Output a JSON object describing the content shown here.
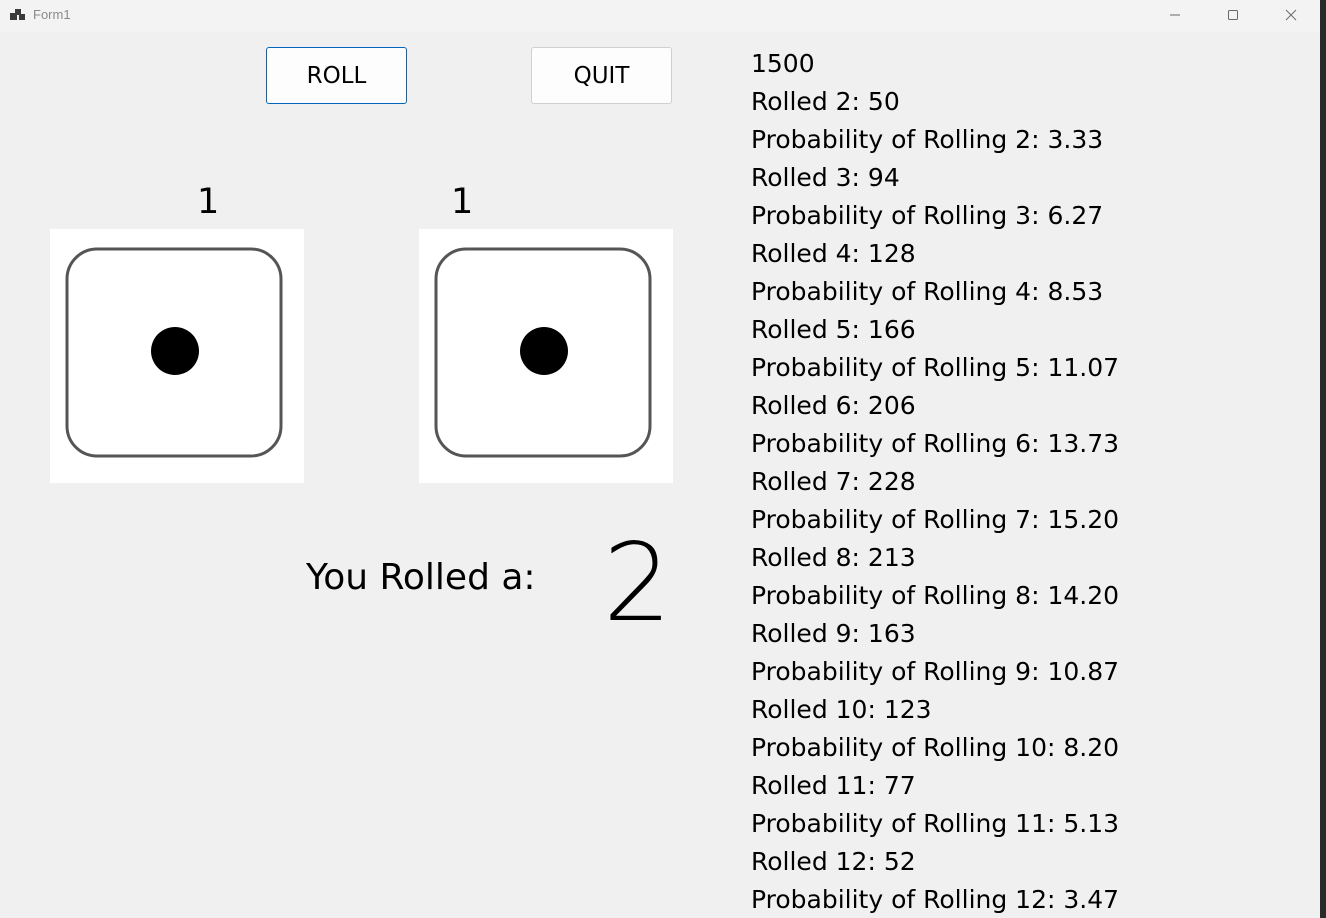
{
  "window": {
    "title": "Form1"
  },
  "buttons": {
    "roll": "ROLL",
    "quit": "QUIT"
  },
  "dice": {
    "die1_value": "1",
    "die2_value": "1"
  },
  "result": {
    "label": "You Rolled a:",
    "total": "2"
  },
  "stats": {
    "total_rolls": "1500",
    "lines": [
      "Rolled 2: 50",
      "Probability of Rolling 2: 3.33",
      "Rolled 3: 94",
      "Probability of Rolling 3: 6.27",
      "Rolled 4: 128",
      "Probability of Rolling 4: 8.53",
      "Rolled 5: 166",
      "Probability of Rolling 5: 11.07",
      "Rolled 6: 206",
      "Probability of Rolling 6: 13.73",
      "Rolled 7: 228",
      "Probability of Rolling 7: 15.20",
      "Rolled 8: 213",
      "Probability of Rolling 8: 14.20",
      "Rolled 9: 163",
      "Probability of Rolling 9: 10.87",
      "Rolled 10: 123",
      "Probability of Rolling 10: 8.20",
      "Rolled 11: 77",
      "Probability of Rolling 11: 5.13",
      "Rolled 12: 52",
      "Probability of Rolling 12: 3.47"
    ]
  },
  "colors": {
    "window_bg": "#f0f0f0",
    "accent_border": "#0067c0"
  },
  "icons": {
    "app": "app-icon",
    "minimize": "minimize-icon",
    "maximize": "maximize-icon",
    "close": "close-icon"
  }
}
